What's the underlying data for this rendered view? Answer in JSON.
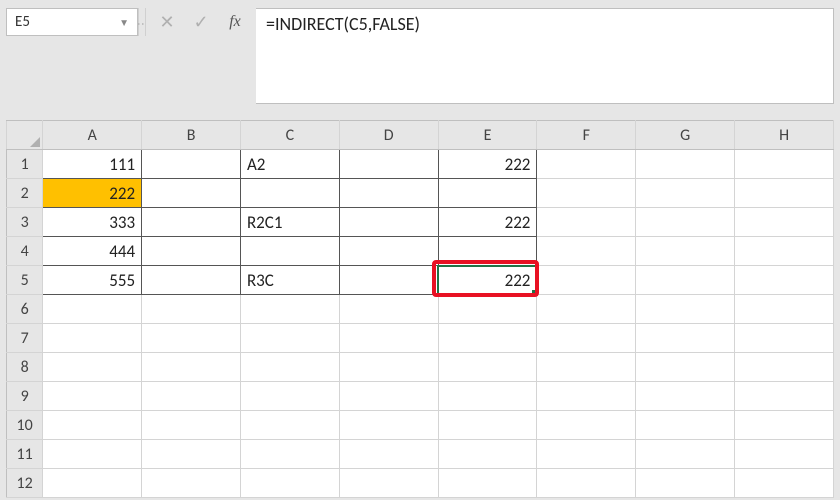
{
  "nameBox": {
    "value": "E5"
  },
  "formulaBar": {
    "value": "=INDIRECT(C5,FALSE)"
  },
  "columns": [
    "A",
    "B",
    "C",
    "D",
    "E",
    "F",
    "G",
    "H"
  ],
  "rows": [
    "1",
    "2",
    "3",
    "4",
    "5",
    "6",
    "7",
    "8",
    "9",
    "10",
    "11",
    "12"
  ],
  "cells": {
    "A1": "111",
    "A2": "222",
    "A3": "333",
    "A4": "444",
    "A5": "555",
    "C1": "A2",
    "C3": "R2C1",
    "C5": "R3C",
    "E1": "222",
    "E3": "222",
    "E5": "222"
  },
  "selectedCell": "E5",
  "highlightedCell": "E5",
  "filledCell": "A2",
  "chart_data": {
    "type": "table",
    "columns": [
      "A",
      "B",
      "C",
      "D",
      "E"
    ],
    "rows": [
      {
        "A": 111,
        "C": "A2",
        "E": 222
      },
      {
        "A": 222
      },
      {
        "A": 333,
        "C": "R2C1",
        "E": 222
      },
      {
        "A": 444
      },
      {
        "A": 555,
        "C": "R3C",
        "E": 222
      }
    ]
  }
}
